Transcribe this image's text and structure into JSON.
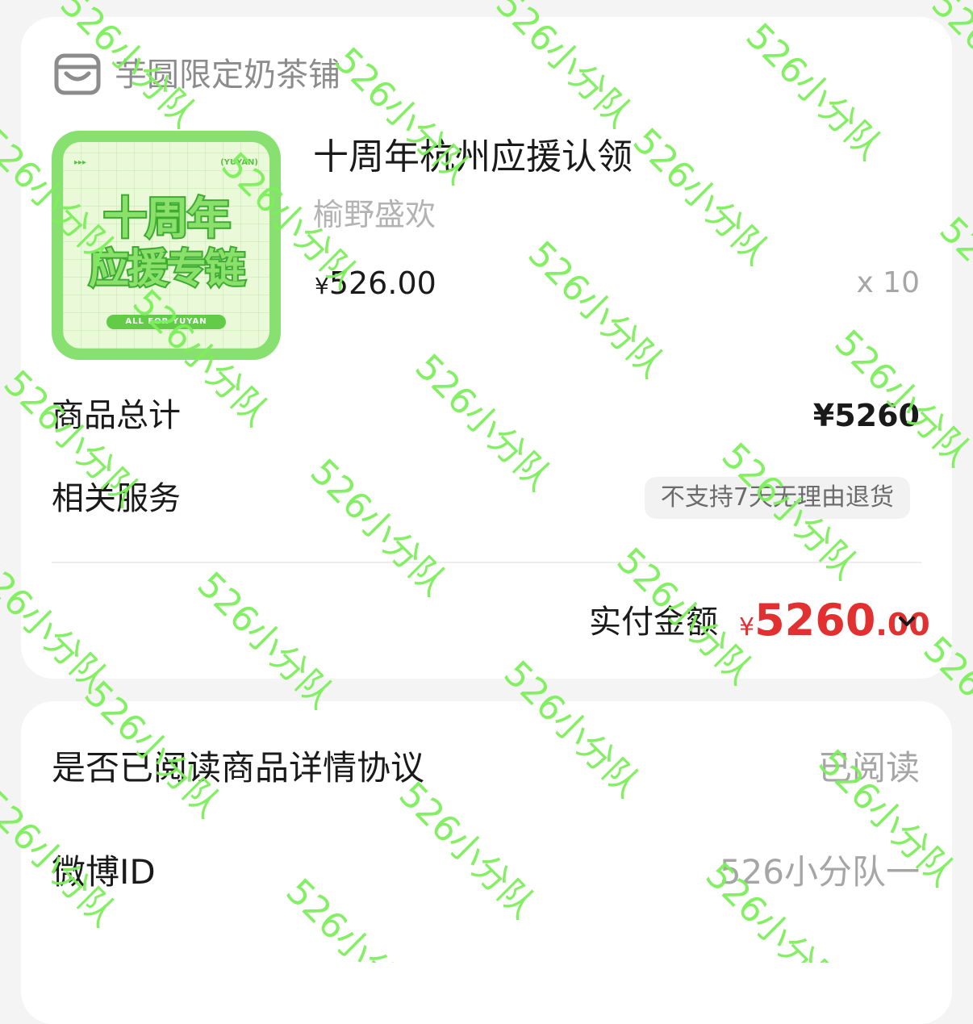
{
  "store": {
    "name": "芋圆限定奶茶铺",
    "icon": "store-icon"
  },
  "product": {
    "title": "十周年杭州应援认领",
    "subtitle": "榆野盛欢",
    "price_currency": "¥",
    "price": "526.00",
    "quantity": "x 10",
    "image": {
      "line1": "十周年",
      "line2": "应援专链",
      "tag": "(YUYAN)",
      "arrows": "▸▸▸",
      "pill": "ALL FOR YUYAN",
      "accent": "#62cc48"
    }
  },
  "summary": {
    "total_label": "商品总计",
    "total_value": "¥5260",
    "service_label": "相关服务",
    "service_badge": "不支持7天无理由退货",
    "paid_label": "实付金额",
    "paid_currency": "¥",
    "paid_integer": "5260",
    "paid_decimal": ".00",
    "paid_color": "#e23030",
    "expand_icon": "chevron-down-icon"
  },
  "details": [
    {
      "label": "是否已阅读商品详情协议",
      "value": "已阅读"
    },
    {
      "label": "微博ID",
      "value": "526小分队一"
    }
  ],
  "watermark": {
    "text": "526小分队",
    "color": "#7cf05a"
  }
}
